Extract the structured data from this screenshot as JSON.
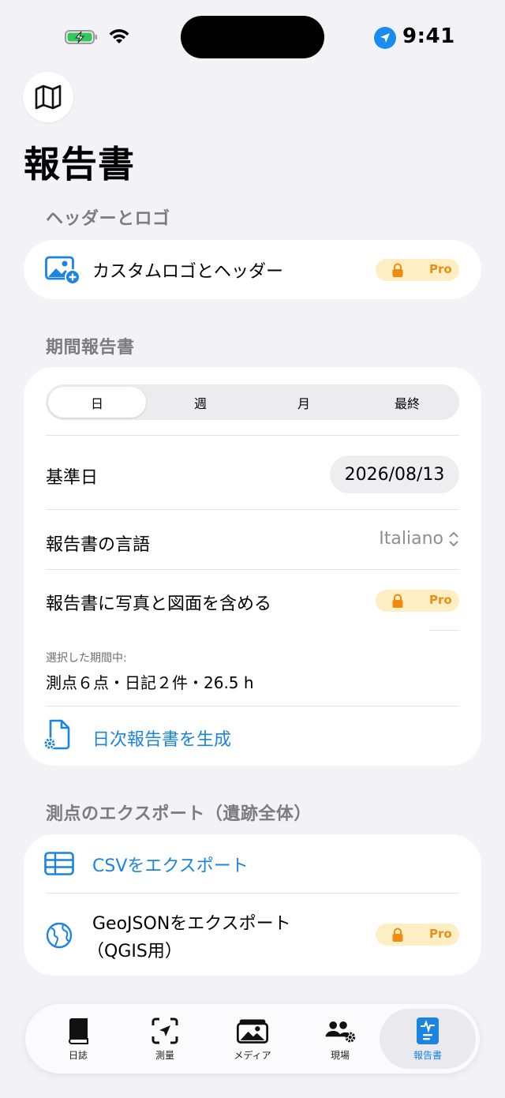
{
  "status_bar": {
    "time": "9:41"
  },
  "page": {
    "title": "報告書"
  },
  "sections": {
    "header_logo": {
      "title": "ヘッダーとロゴ",
      "custom_logo_label": "カスタムロゴとヘッダー",
      "pro_label": "Pro"
    },
    "period_report": {
      "title": "期間報告書",
      "segments": [
        "日",
        "週",
        "月",
        "最終"
      ],
      "selected_segment": "日",
      "base_date_label": "基準日",
      "base_date_value": "2026/08/13",
      "language_label": "報告書の言語",
      "language_value": "Italiano",
      "include_photos_label": "報告書に写真と図面を含める",
      "pro_label": "Pro",
      "selected_period_caption": "選択した期間中:",
      "selected_period_summary": "測点６点・日記２件・26.5 h",
      "generate_label": "日次報告書を生成"
    },
    "export": {
      "title": "測点のエクスポート（遺跡全体）",
      "csv_label": "CSVをエクスポート",
      "geojson_label_line1": "GeoJSONをエクスポート",
      "geojson_label_line2": "（QGIS用）",
      "pro_label": "Pro"
    }
  },
  "tabbar": {
    "items": [
      {
        "label": "日誌",
        "icon": "book-icon"
      },
      {
        "label": "測量",
        "icon": "location-scan-icon"
      },
      {
        "label": "メディア",
        "icon": "photos-icon"
      },
      {
        "label": "現場",
        "icon": "team-settings-icon"
      },
      {
        "label": "報告書",
        "icon": "report-icon"
      }
    ],
    "active": "報告書"
  },
  "colors": {
    "accent": "#1a84e0",
    "pro_badge_bg": "#fdeec4",
    "pro_badge_fg": "#e8901b",
    "background": "#f2f2f7"
  }
}
